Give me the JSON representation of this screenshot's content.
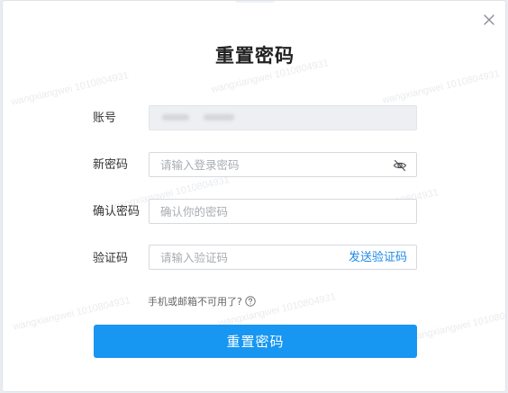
{
  "dialog": {
    "title": "重置密码",
    "watermark_text": "wangxiangwei 1010804931"
  },
  "form": {
    "account": {
      "label": "账号"
    },
    "new_password": {
      "label": "新密码",
      "placeholder": "请输入登录密码",
      "value": ""
    },
    "confirm_password": {
      "label": "确认密码",
      "placeholder": "确认你的密码",
      "value": ""
    },
    "verification_code": {
      "label": "验证码",
      "placeholder": "请输入验证码",
      "value": "",
      "send_label": "发送验证码"
    }
  },
  "help": {
    "unusable_text": "手机或邮箱不可用了?"
  },
  "actions": {
    "submit_label": "重置密码"
  },
  "colors": {
    "primary": "#1796f2",
    "link": "#1e88e5",
    "title": "#222222",
    "label": "#333333",
    "placeholder": "#a9adb3",
    "disabled_bg": "#edeff2"
  },
  "icons": {
    "close": "close-icon",
    "password_visibility": "eye-off-icon",
    "help": "question-circle-icon"
  }
}
